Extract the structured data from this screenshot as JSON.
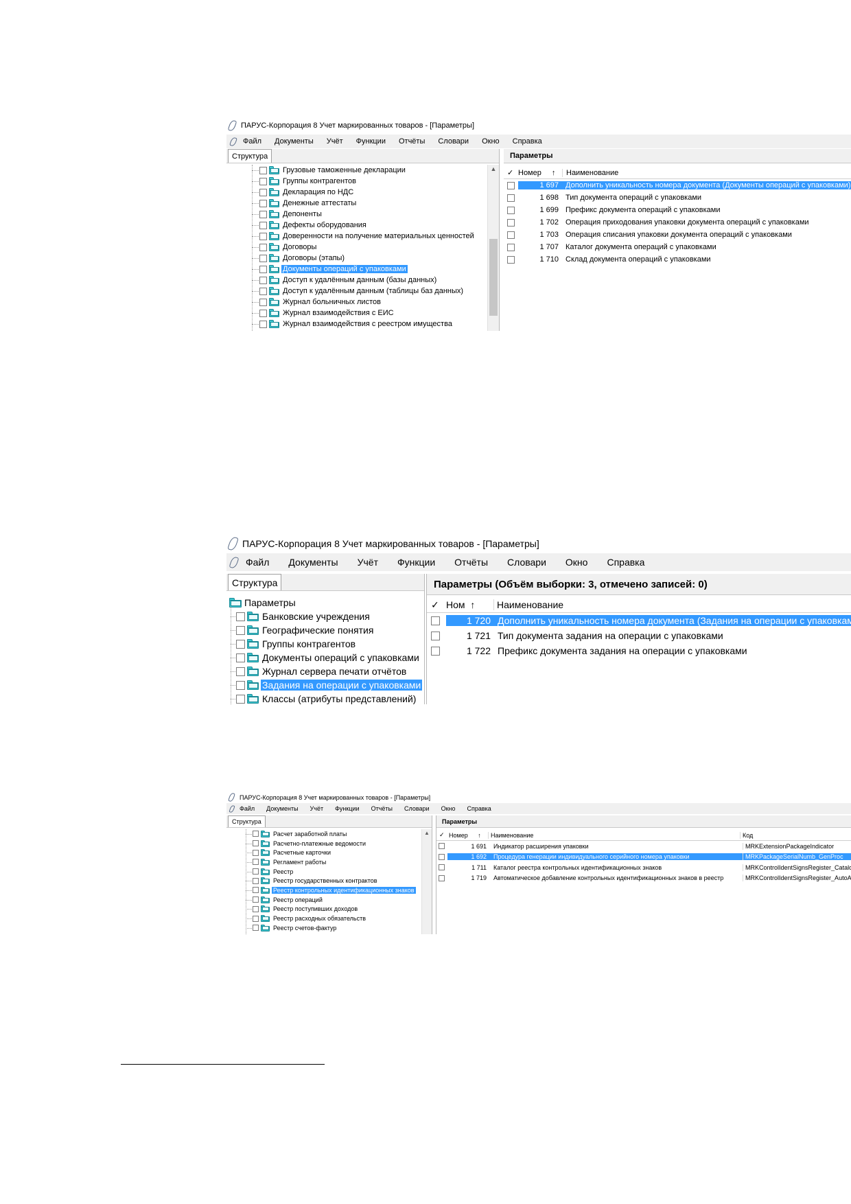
{
  "screenshots": [
    {
      "title": "ПАРУС-Корпорация 8 Учет маркированных товаров - [Параметры]",
      "menu": [
        "Файл",
        "Документы",
        "Учёт",
        "Функции",
        "Отчёты",
        "Словари",
        "Окно",
        "Справка"
      ],
      "left_tab": "Структура",
      "tree": [
        {
          "label": "Грузовые таможенные декларации"
        },
        {
          "label": "Группы контрагентов"
        },
        {
          "label": "Декларация по НДС"
        },
        {
          "label": "Денежные аттестаты"
        },
        {
          "label": "Депоненты"
        },
        {
          "label": "Дефекты оборудования"
        },
        {
          "label": "Доверенности на получение материальных ценностей"
        },
        {
          "label": "Договоры"
        },
        {
          "label": "Договоры (этапы)"
        },
        {
          "label": "Документы операций с упаковками",
          "selected": true
        },
        {
          "label": "Доступ к удалённым данным (базы данных)"
        },
        {
          "label": "Доступ к удалённым данным (таблицы баз данных)"
        },
        {
          "label": "Журнал больничных листов"
        },
        {
          "label": "Журнал взаимодействия с ЕИС"
        },
        {
          "label": "Журнал взаимодействия с реестром имущества"
        }
      ],
      "params_header": "Параметры",
      "columns": {
        "check": "✓",
        "num": "Номер",
        "sort": "↑",
        "name": "Наименование"
      },
      "rows": [
        {
          "num": "1 697",
          "name": "Дополнить уникальность номера документа (Документы операций с упаковками)",
          "selected": true
        },
        {
          "num": "1 698",
          "name": "Тип документа операций с упаковками"
        },
        {
          "num": "1 699",
          "name": "Префикс документа операций с упаковками"
        },
        {
          "num": "1 702",
          "name": "Операция приходования упаковки документа операций с упаковками"
        },
        {
          "num": "1 703",
          "name": "Операция списания упаковки документа операций с упаковками"
        },
        {
          "num": "1 707",
          "name": "Каталог документа операций с упаковками"
        },
        {
          "num": "1 710",
          "name": "Склад документа операций с упаковками"
        }
      ]
    },
    {
      "title": "ПАРУС-Корпорация 8 Учет маркированных товаров - [Параметры]",
      "menu": [
        "Файл",
        "Документы",
        "Учёт",
        "Функции",
        "Отчёты",
        "Словари",
        "Окно",
        "Справка"
      ],
      "left_tab": "Структура",
      "tree_root": "Параметры",
      "tree": [
        {
          "label": "Банковские учреждения"
        },
        {
          "label": "Географические понятия"
        },
        {
          "label": "Группы контрагентов"
        },
        {
          "label": "Документы операций с упаковками"
        },
        {
          "label": "Журнал сервера печати отчётов"
        },
        {
          "label": "Задания на операции с упаковками",
          "selected": true
        },
        {
          "label": "Классы (атрибуты представлений)"
        }
      ],
      "params_header": "Параметры (Объём выборки: 3, отмечено записей: 0)",
      "columns": {
        "check": "✓",
        "num": "Ном",
        "sort": "↑",
        "name": "Наименование"
      },
      "rows": [
        {
          "num": "1 720",
          "name": "Дополнить уникальность номера документа (Задания на операции с упаковками)",
          "selected": true
        },
        {
          "num": "1 721",
          "name": "Тип документа задания на операции с упаковками"
        },
        {
          "num": "1 722",
          "name": "Префикс документа задания на операции с упаковками"
        }
      ]
    },
    {
      "title": "ПАРУС-Корпорация 8 Учет маркированных товаров - [Параметры]",
      "menu": [
        "Файл",
        "Документы",
        "Учёт",
        "Функции",
        "Отчёты",
        "Словари",
        "Окно",
        "Справка"
      ],
      "left_tab": "Структура",
      "tree": [
        {
          "label": "Расчет заработной платы"
        },
        {
          "label": "Расчетно-платежные ведомости"
        },
        {
          "label": "Расчетные карточки"
        },
        {
          "label": "Регламент работы"
        },
        {
          "label": "Реестр"
        },
        {
          "label": "Реестр государственных контрактов"
        },
        {
          "label": "Реестр контрольных идентификационных знаков",
          "selected": true
        },
        {
          "label": "Реестр операций"
        },
        {
          "label": "Реестр поступивших доходов"
        },
        {
          "label": "Реестр расходных обязательств"
        },
        {
          "label": "Реестр счетов-фактур"
        }
      ],
      "params_header": "Параметры",
      "columns": {
        "check": "✓",
        "num": "Номер",
        "sort": "↑",
        "name": "Наименование",
        "code": "Код"
      },
      "rows": [
        {
          "num": "1 691",
          "name": "Индикатор расширения упаковки",
          "code": "MRKExtensionPackageIndicator"
        },
        {
          "num": "1 692",
          "name": "Процедура генерации индивидуального серийного номера упаковки",
          "code": "MRKPackageSerialNumb_GenProc",
          "selected": true
        },
        {
          "num": "1 711",
          "name": "Каталог реестра контрольных идентификационных знаков",
          "code": "MRKControlIdentSignsRegister_Catalog"
        },
        {
          "num": "1 719",
          "name": "Автоматическое добавление контрольных идентификационных знаков в реестр",
          "code": "MRKControlIdentSignsRegister_AutoAdd"
        }
      ]
    }
  ]
}
